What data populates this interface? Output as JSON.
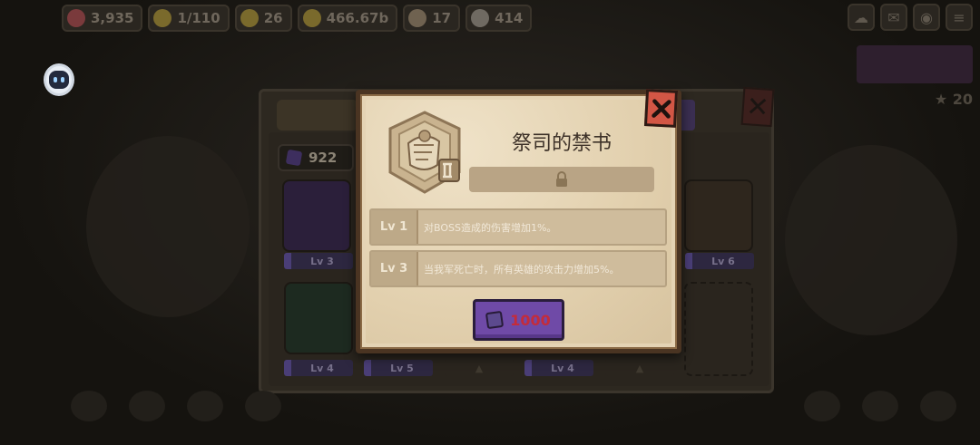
{
  "resources": [
    {
      "name": "ruby-icon",
      "value": "3,935",
      "color": "#7a3a3c"
    },
    {
      "name": "energy-icon",
      "value": "1/110",
      "color": "#7a6a2c"
    },
    {
      "name": "trophy-icon",
      "value": "26",
      "color": "#7a6a2c"
    },
    {
      "name": "coin-icon",
      "value": "466.67b",
      "color": "#7a6a2c"
    },
    {
      "name": "ore-icon",
      "value": "17",
      "color": "#6f6250"
    },
    {
      "name": "stone-icon",
      "value": "414",
      "color": "#6f6a62"
    }
  ],
  "back_panel": {
    "currency_value": "922",
    "card_levels": [
      "Lv 3",
      "Lv 6",
      "Lv 4",
      "Lv 5",
      "Lv 4"
    ],
    "star_count": "20"
  },
  "modal": {
    "title": "祭司的禁书",
    "effects": [
      {
        "level": "Lv 1",
        "text": "对BOSS造成的伤害增加1%。"
      },
      {
        "level": "Lv 3",
        "text": "当我军死亡时，所有英雄的攻击力增加5%。"
      }
    ],
    "price": "1000",
    "colors": {
      "accent": "#6f4aa7",
      "price": "#c42c3a",
      "close": "#d25645"
    }
  }
}
